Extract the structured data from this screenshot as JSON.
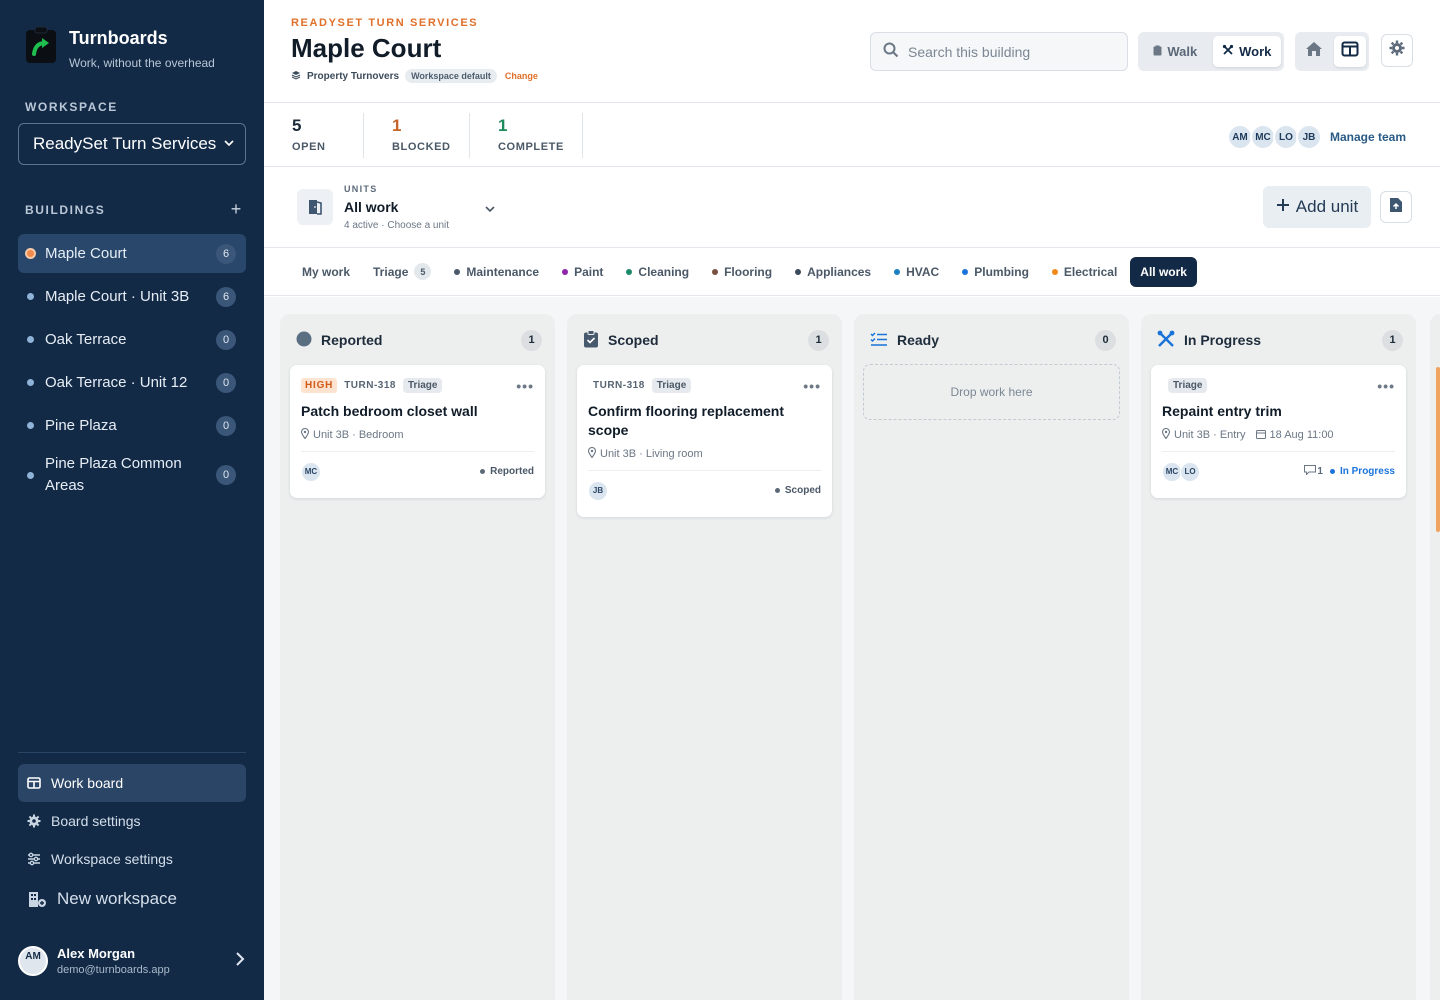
{
  "brand": {
    "title": "Turnboards",
    "subtitle": "Work, without the overhead"
  },
  "sidebar": {
    "workspace_label": "WORKSPACE",
    "workspace_value": "ReadySet Turn Services",
    "buildings_label": "BUILDINGS",
    "buildings": [
      {
        "name": "Maple Court",
        "count": "6",
        "active": true
      },
      {
        "name": "Maple Court · Unit 3B",
        "count": "6"
      },
      {
        "name": "Oak Terrace",
        "count": "0"
      },
      {
        "name": "Oak Terrace · Unit 12",
        "count": "0"
      },
      {
        "name": "Pine Plaza",
        "count": "0"
      },
      {
        "name": "Pine Plaza Common Areas",
        "count": "0"
      }
    ],
    "nav": [
      {
        "label": "Work board",
        "icon": "board-icon"
      },
      {
        "label": "Board settings",
        "icon": "gear-icon"
      },
      {
        "label": "Workspace settings",
        "icon": "sliders-icon"
      },
      {
        "label": "New workspace",
        "icon": "building-add-icon"
      }
    ],
    "user": {
      "initials": "AM",
      "name": "Alex Morgan",
      "email": "demo@turnboards.app"
    }
  },
  "header": {
    "eyebrow": "READYSET TURN SERVICES",
    "title": "Maple Court",
    "board_type": "Property Turnovers",
    "default_pill": "Workspace default",
    "change": "Change",
    "search_placeholder": "Search this building",
    "mode_walk": "Walk",
    "mode_work": "Work"
  },
  "stats": [
    {
      "value": "5",
      "label": "OPEN",
      "color": "#1b2a3a"
    },
    {
      "value": "1",
      "label": "BLOCKED",
      "color": "#c8642a"
    },
    {
      "value": "1",
      "label": "COMPLETE",
      "color": "#1f8a5b"
    }
  ],
  "team": {
    "members": [
      "AM",
      "MC",
      "LO",
      "JB"
    ],
    "manage": "Manage team"
  },
  "units": {
    "label": "UNITS",
    "value": "All work",
    "sub": "4 active · Choose a unit",
    "add": "Add unit"
  },
  "filters": [
    {
      "label": "My work"
    },
    {
      "label": "Triage",
      "count": "5"
    },
    {
      "label": "Maintenance",
      "dot": "#4a5867"
    },
    {
      "label": "Paint",
      "dot": "#8e24aa"
    },
    {
      "label": "Cleaning",
      "dot": "#1b8a6b"
    },
    {
      "label": "Flooring",
      "dot": "#7a5140"
    },
    {
      "label": "Appliances",
      "dot": "#3b4a5a"
    },
    {
      "label": "HVAC",
      "dot": "#1a7fc1"
    },
    {
      "label": "Plumbing",
      "dot": "#1a73d9"
    },
    {
      "label": "Electrical",
      "dot": "#ef8a1a"
    },
    {
      "label": "All work",
      "active": true
    }
  ],
  "columns": [
    {
      "title": "Reported",
      "count": "1"
    },
    {
      "title": "Scoped",
      "count": "1"
    },
    {
      "title": "Ready",
      "count": "0",
      "empty": "Drop work here"
    },
    {
      "title": "In Progress",
      "count": "1"
    }
  ],
  "cards": [
    {
      "priority": "HIGH",
      "id": "TURN-318",
      "tag": "Triage",
      "title": "Patch bedroom closet wall",
      "location": "Unit 3B · Bedroom",
      "assignees": [
        "MC"
      ],
      "status": "Reported"
    },
    {
      "id": "TURN-318",
      "tag": "Triage",
      "title": "Confirm flooring replacement scope",
      "location": "Unit 3B · Living room",
      "assignees": [
        "JB"
      ],
      "status": "Scoped"
    },
    {
      "tag": "Triage",
      "title": "Repaint entry trim",
      "location": "Unit 3B · Entry",
      "date": "18 Aug 11:00",
      "assignees": [
        "MC",
        "LO"
      ],
      "comments": "1",
      "status": "In Progress",
      "status_color": "#1a73d9"
    }
  ]
}
